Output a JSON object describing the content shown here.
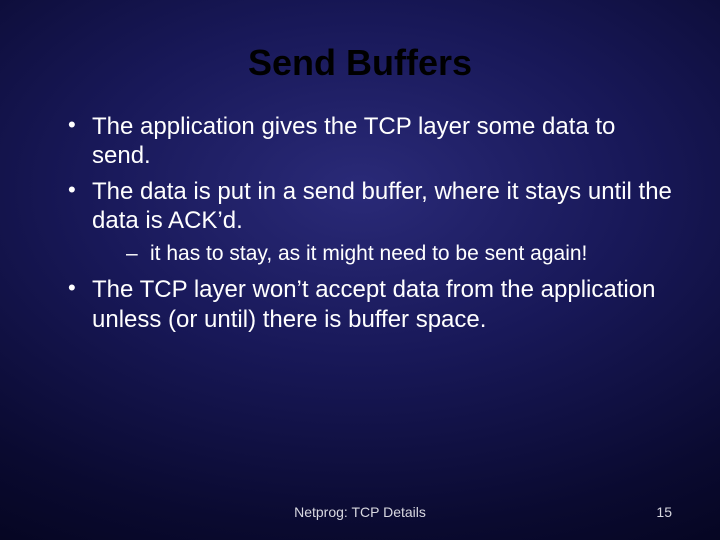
{
  "title": "Send Buffers",
  "bullets": {
    "b1": "The application gives the TCP layer some data to send.",
    "b2": "The data is put in a send buffer, where it stays until the data is ACK’d.",
    "b2_sub1": "it has to stay, as it might need to be sent again!",
    "b3": "The TCP layer won’t accept data from the application unless (or until) there is buffer space."
  },
  "footer": "Netprog:   TCP Details",
  "page": "15"
}
